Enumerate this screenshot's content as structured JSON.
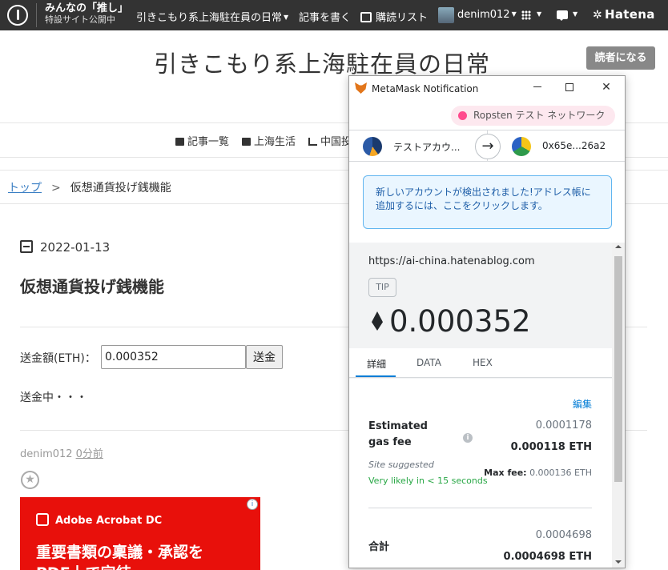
{
  "topbar": {
    "oshi_line1": "みんなの「推し」",
    "oshi_line2": "特設サイト公開中",
    "blog_menu": "引きこもり系上海駐在員の日常",
    "write": "記事を書く",
    "reading_list": "購読リスト",
    "username": "denim012",
    "hatena": "Hatena"
  },
  "blog": {
    "title": "引きこもり系上海駐在員の日常",
    "subscribe": "読者になる",
    "nav": [
      "記事一覧",
      "上海生活",
      "中国投"
    ],
    "breadcrumb_top": "トップ",
    "breadcrumb_sep": ">",
    "breadcrumb_current": "仮想通貨投げ銭機能",
    "date": "2022-01-13",
    "post_title": "仮想通貨投げ銭機能",
    "send_label": "送金額(ETH)：",
    "send_value": "0.000352",
    "send_button": "送金",
    "sending_text": "送金中・・・",
    "author": "denim012",
    "posted_ago": "0分前"
  },
  "ad": {
    "brand": "Adobe Acrobat DC",
    "text_line1": "重要書類の稟議・承認を",
    "text_line2": "PDF上で完結"
  },
  "metamask": {
    "window_title": "MetaMask Notification",
    "network": "Ropsten テスト ネットワーク",
    "from_account": "テストアカウ...",
    "to_address": "0x65e...26a2",
    "notice": "新しいアカウントが検出されました!アドレス帳に追加するには、ここをクリックします。",
    "origin": "https://ai-china.hatenablog.com",
    "method_badge": "TIP",
    "amount": "0.000352",
    "tabs": [
      "詳細",
      "DATA",
      "HEX"
    ],
    "edit": "編集",
    "gas_label": "Estimated gas fee",
    "gas_value_gray": "0.0001178",
    "gas_value_eth": "0.000118 ETH",
    "site_suggested": "Site suggested",
    "likely": "Very likely in < 15 seconds",
    "max_fee_label": "Max fee:",
    "max_fee_value": "0.000136 ETH",
    "total_label": "合計",
    "total_gray": "0.0004698",
    "total_eth": "0.0004698 ETH"
  },
  "colors": {
    "topbar_bg": "#333333",
    "metamask_blue": "#037dd6",
    "network_dot": "#ff4a8d",
    "ad_red": "#e8100b",
    "likely_green": "#28a745"
  }
}
